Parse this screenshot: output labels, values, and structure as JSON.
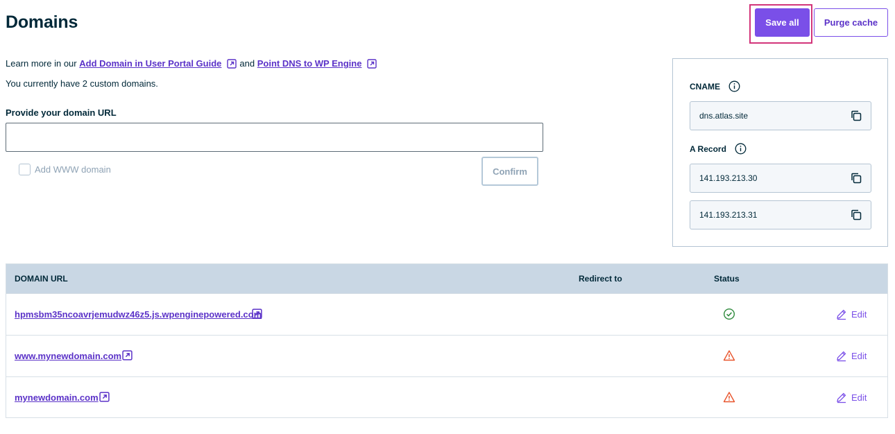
{
  "header": {
    "title": "Domains",
    "save_label": "Save all",
    "purge_label": "Purge cache"
  },
  "intro": {
    "prefix": "Learn more in our",
    "link1": "Add Domain in User Portal Guide",
    "joiner": "and",
    "link2": "Point DNS to WP Engine",
    "count_text": "You currently have 2 custom domains."
  },
  "form": {
    "label": "Provide your domain URL",
    "value": "",
    "placeholder": "",
    "www_label": "Add WWW domain",
    "www_checked": false,
    "confirm_label": "Confirm"
  },
  "dns": {
    "cname_label": "CNAME",
    "cname_value": "dns.atlas.site",
    "a_label": "A Record",
    "a_values": [
      "141.193.213.30",
      "141.193.213.31"
    ]
  },
  "table": {
    "headers": {
      "domain": "DOMAIN URL",
      "redirect": "Redirect to",
      "status": "Status"
    },
    "edit_label": "Edit",
    "rows": [
      {
        "domain": "hpmsbm35ncoavrjemudwz46z5.js.wpenginepowered.com",
        "redirect": "",
        "status": "ok"
      },
      {
        "domain": "www.mynewdomain.com",
        "redirect": "",
        "status": "warning"
      },
      {
        "domain": "mynewdomain.com",
        "redirect": "",
        "status": "warning"
      }
    ]
  },
  "colors": {
    "accent": "#7a4fe8",
    "link": "#5b32c8",
    "highlight": "#d2347a",
    "ok": "#2e8a3c",
    "warning": "#e8542c",
    "table_header": "#c9d7e4"
  }
}
